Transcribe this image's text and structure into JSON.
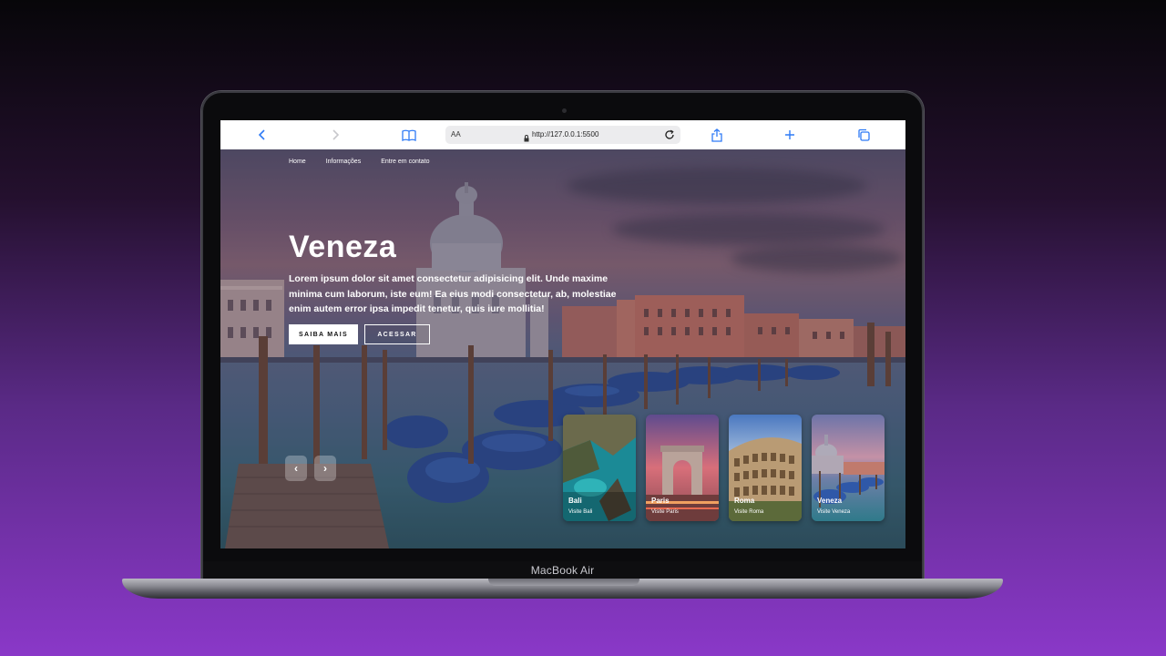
{
  "device": {
    "model": "MacBook Air"
  },
  "browser": {
    "address_prefix": "AA",
    "url": "http://127.0.0.1:5500"
  },
  "nav": {
    "items": [
      {
        "label": "Home"
      },
      {
        "label": "Informações"
      },
      {
        "label": "Entre em contato"
      }
    ]
  },
  "hero": {
    "title": "Veneza",
    "description": "Lorem ipsum dolor sit amet consectetur adipisicing elit. Unde maxime minima cum laborum, iste eum! Ea eius modi consectetur, ab, molestiae enim autem error ipsa impedit tenetur, quis iure mollitia!",
    "buttons": {
      "primary": "SAIBA MAIS",
      "secondary": "ACESSAR"
    },
    "prev_glyph": "‹",
    "next_glyph": "›"
  },
  "cards": [
    {
      "title": "Bali",
      "subtitle": "Visite Bali"
    },
    {
      "title": "Paris",
      "subtitle": "Visite Paris"
    },
    {
      "title": "Roma",
      "subtitle": "Visite Roma"
    },
    {
      "title": "Veneza",
      "subtitle": "Visite Veneza"
    }
  ],
  "colors": {
    "accent": "#2f7bf6",
    "background_top": "#070609",
    "background_bottom": "#8a38c8"
  }
}
